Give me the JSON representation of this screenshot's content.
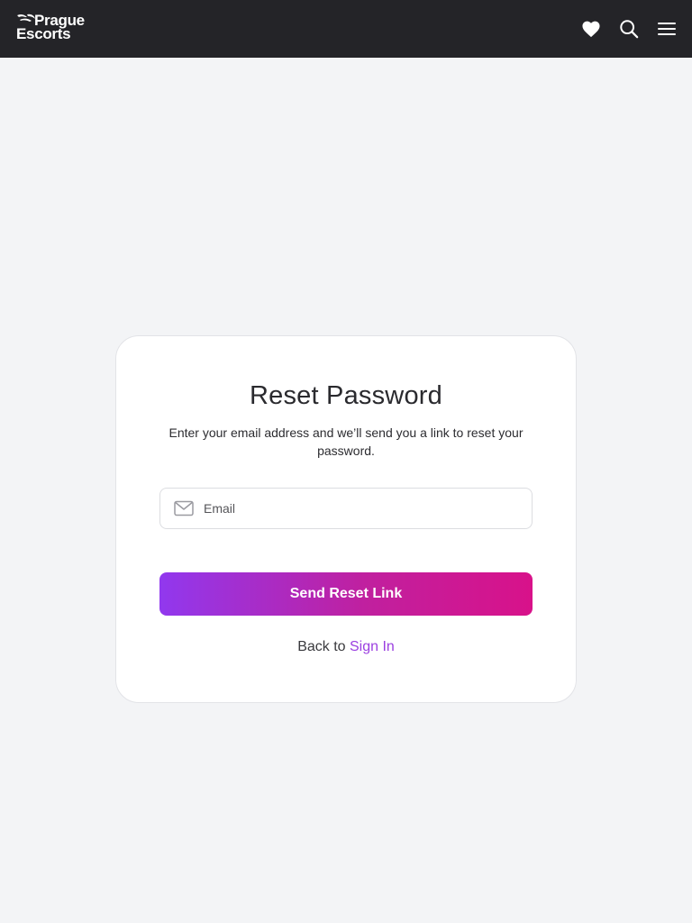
{
  "header": {
    "logo_line1": "Prague",
    "logo_line2": "Escorts",
    "icons": [
      "heart-icon",
      "search-icon",
      "menu-icon"
    ],
    "background": "#242428"
  },
  "reset_form": {
    "title": "Reset Password",
    "subtitle": "Enter your email address and we’ll send you a link to reset your password.",
    "email": {
      "icon": "mail-icon",
      "placeholder": "Email",
      "value": ""
    },
    "submit_label": "Send Reset Link",
    "back_text": "Back to",
    "signin_label": "Sign In"
  },
  "colors": {
    "page_background": "#f3f4f6",
    "accent_purple": "#9138ee",
    "accent_pink": "#d8128a",
    "link": "#9b3fe0"
  }
}
